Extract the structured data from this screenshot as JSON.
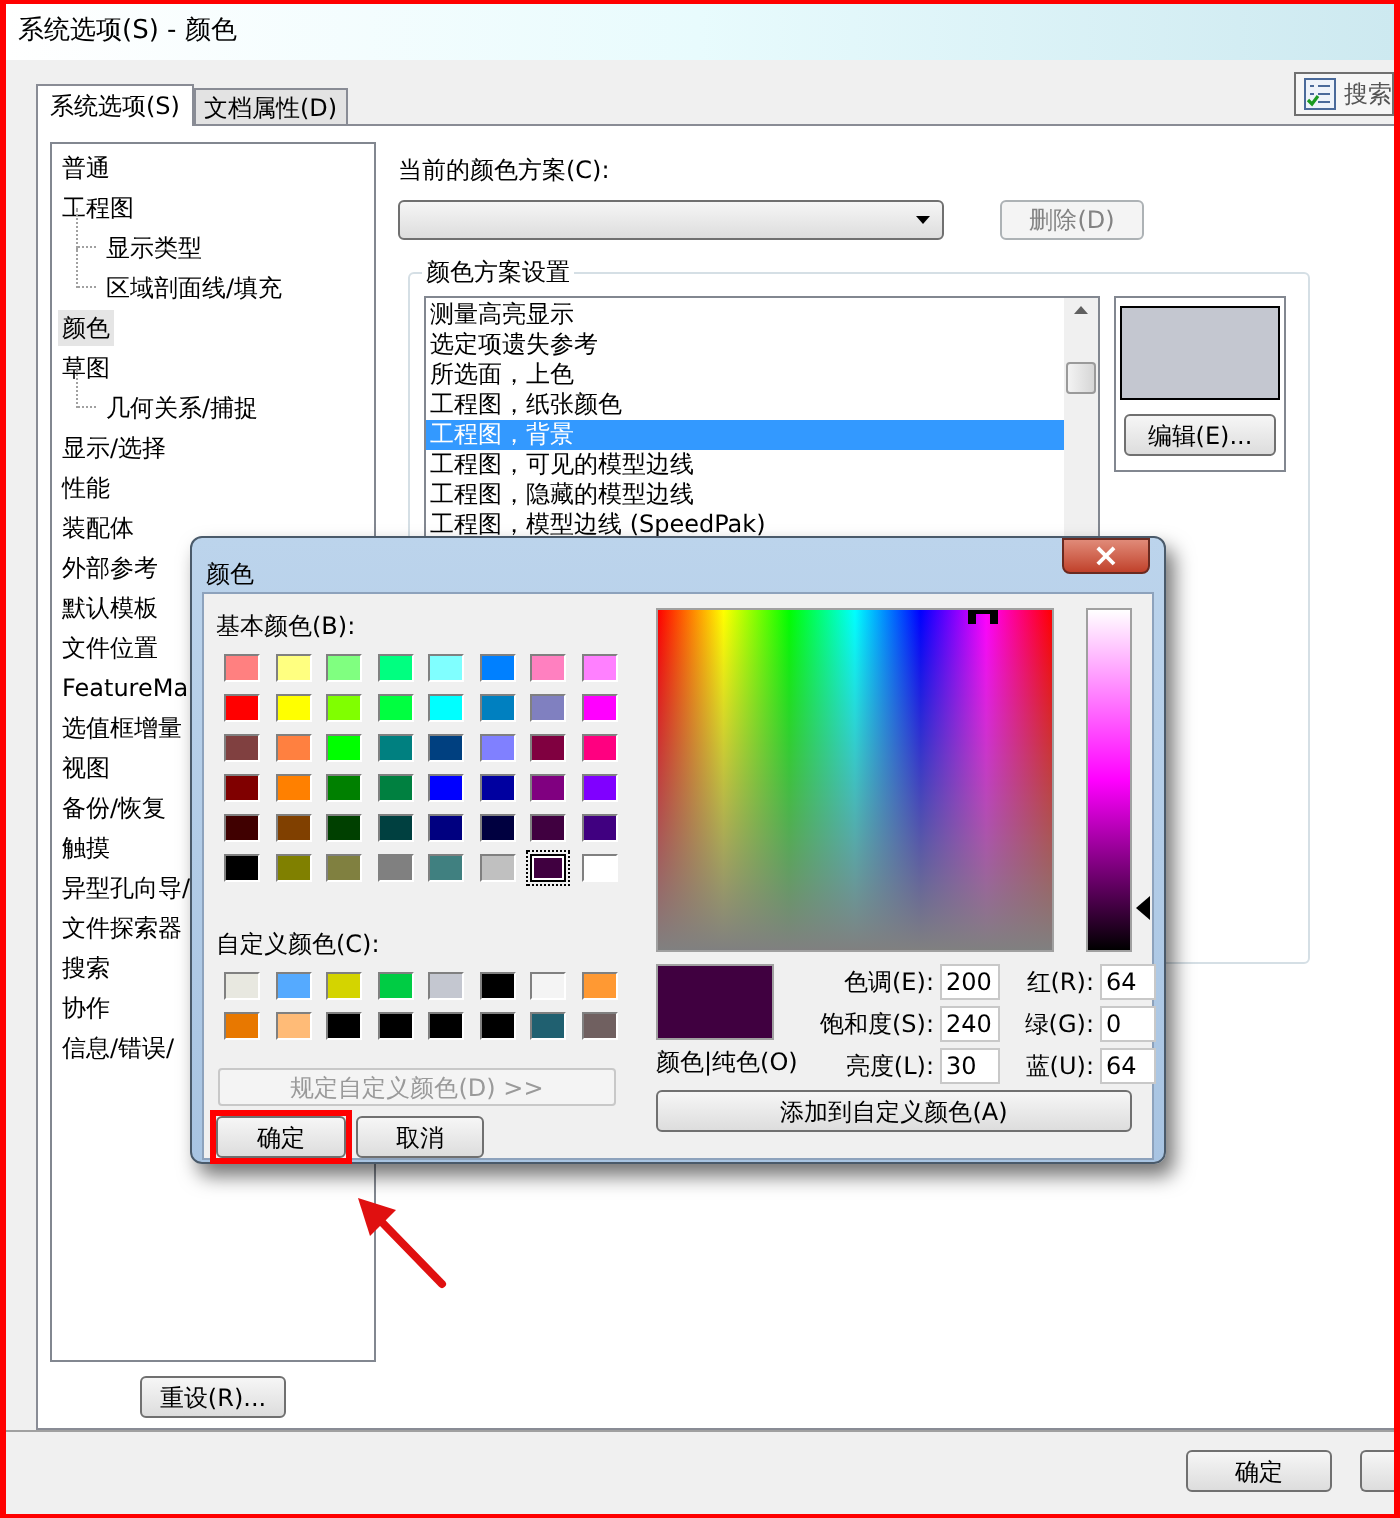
{
  "window": {
    "title": "系统选项(S) - 颜色"
  },
  "tabs": [
    {
      "label": "系统选项(S)",
      "selected": true
    },
    {
      "label": "文档属性(D)",
      "selected": false
    }
  ],
  "search_button": {
    "label": "搜索"
  },
  "tree": [
    {
      "label": "普通",
      "selected": false
    },
    {
      "label": "工程图",
      "selected": false,
      "children": [
        {
          "label": "显示类型",
          "selected": false
        },
        {
          "label": "区域剖面线/填充",
          "selected": false
        }
      ]
    },
    {
      "label": "颜色",
      "selected": true
    },
    {
      "label": "草图",
      "selected": false,
      "children": [
        {
          "label": "几何关系/捕捉",
          "selected": false
        }
      ]
    },
    {
      "label": "显示/选择",
      "selected": false
    },
    {
      "label": "性能",
      "selected": false
    },
    {
      "label": "装配体",
      "selected": false
    },
    {
      "label": "外部参考",
      "selected": false
    },
    {
      "label": "默认模板",
      "selected": false
    },
    {
      "label": "文件位置",
      "selected": false
    },
    {
      "label": "FeatureMa",
      "selected": false
    },
    {
      "label": "选值框增量",
      "selected": false
    },
    {
      "label": "视图",
      "selected": false
    },
    {
      "label": "备份/恢复",
      "selected": false
    },
    {
      "label": "触摸",
      "selected": false
    },
    {
      "label": "异型孔向导/",
      "selected": false
    },
    {
      "label": "文件探索器",
      "selected": false
    },
    {
      "label": "搜索",
      "selected": false
    },
    {
      "label": "协作",
      "selected": false
    },
    {
      "label": "信息/错误/",
      "selected": false
    }
  ],
  "reset_button": {
    "label": "重设(R)..."
  },
  "color_scheme": {
    "label": "当前的颜色方案(C):",
    "delete_button": {
      "label": "删除(D)",
      "disabled": true
    }
  },
  "scheme_settings": {
    "title": "颜色方案设置",
    "items": [
      {
        "label": "测量高亮显示",
        "selected": false
      },
      {
        "label": "选定项遗失参考",
        "selected": false
      },
      {
        "label": "所选面，上色",
        "selected": false
      },
      {
        "label": "工程图，纸张颜色",
        "selected": false
      },
      {
        "label": "工程图，背景",
        "selected": true
      },
      {
        "label": "工程图，可见的模型边线",
        "selected": false
      },
      {
        "label": "工程图，隐藏的模型边线",
        "selected": false
      },
      {
        "label": "工程图，模型边线 (SpeedPak)",
        "selected": false
      }
    ],
    "swatch": {
      "color": "#c4c7d0"
    },
    "edit_button": {
      "label": "编辑(E)..."
    }
  },
  "footer_buttons": [
    {
      "label": "确定"
    }
  ],
  "color_dialog": {
    "title": "颜色",
    "close_label": "×",
    "basic_label": "基本颜色(B):",
    "basic_colors": [
      {
        "color": "#ff8080",
        "selected": false
      },
      {
        "color": "#ffff80",
        "selected": false
      },
      {
        "color": "#80ff80",
        "selected": false
      },
      {
        "color": "#00ff80",
        "selected": false
      },
      {
        "color": "#80ffff",
        "selected": false
      },
      {
        "color": "#0080ff",
        "selected": false
      },
      {
        "color": "#ff80c0",
        "selected": false
      },
      {
        "color": "#ff80ff",
        "selected": false
      },
      {
        "color": "#ff0000",
        "selected": false
      },
      {
        "color": "#ffff00",
        "selected": false
      },
      {
        "color": "#80ff00",
        "selected": false
      },
      {
        "color": "#00ff40",
        "selected": false
      },
      {
        "color": "#00ffff",
        "selected": false
      },
      {
        "color": "#0080c0",
        "selected": false
      },
      {
        "color": "#8080c0",
        "selected": false
      },
      {
        "color": "#ff00ff",
        "selected": false
      },
      {
        "color": "#804040",
        "selected": false
      },
      {
        "color": "#ff8040",
        "selected": false
      },
      {
        "color": "#00ff00",
        "selected": false
      },
      {
        "color": "#008080",
        "selected": false
      },
      {
        "color": "#004080",
        "selected": false
      },
      {
        "color": "#8080ff",
        "selected": false
      },
      {
        "color": "#800040",
        "selected": false
      },
      {
        "color": "#ff0080",
        "selected": false
      },
      {
        "color": "#800000",
        "selected": false
      },
      {
        "color": "#ff8000",
        "selected": false
      },
      {
        "color": "#008000",
        "selected": false
      },
      {
        "color": "#008040",
        "selected": false
      },
      {
        "color": "#0000ff",
        "selected": false
      },
      {
        "color": "#0000a0",
        "selected": false
      },
      {
        "color": "#800080",
        "selected": false
      },
      {
        "color": "#8000ff",
        "selected": false
      },
      {
        "color": "#400000",
        "selected": false
      },
      {
        "color": "#804000",
        "selected": false
      },
      {
        "color": "#004000",
        "selected": false
      },
      {
        "color": "#004040",
        "selected": false
      },
      {
        "color": "#000080",
        "selected": false
      },
      {
        "color": "#000040",
        "selected": false
      },
      {
        "color": "#400040",
        "selected": false
      },
      {
        "color": "#400080",
        "selected": false
      },
      {
        "color": "#000000",
        "selected": false
      },
      {
        "color": "#808000",
        "selected": false
      },
      {
        "color": "#808040",
        "selected": false
      },
      {
        "color": "#808080",
        "selected": false
      },
      {
        "color": "#408080",
        "selected": false
      },
      {
        "color": "#c0c0c0",
        "selected": false
      },
      {
        "color": "#400040",
        "selected": true
      },
      {
        "color": "#ffffff",
        "selected": false
      }
    ],
    "custom_label": "自定义颜色(C):",
    "custom_colors": [
      {
        "color": "#e8e8e0",
        "selected": false
      },
      {
        "color": "#55aaff",
        "selected": false
      },
      {
        "color": "#d4d400",
        "selected": false
      },
      {
        "color": "#00cc44",
        "selected": false
      },
      {
        "color": "#c4c7d0",
        "selected": false
      },
      {
        "color": "#000000",
        "selected": false
      },
      {
        "color": "#f4f4f4",
        "selected": false
      },
      {
        "color": "#ff9933",
        "selected": false
      },
      {
        "color": "#e87800",
        "selected": false
      },
      {
        "color": "#ffbb77",
        "selected": false
      },
      {
        "color": "#000000",
        "selected": false
      },
      {
        "color": "#000000",
        "selected": false
      },
      {
        "color": "#000000",
        "selected": false
      },
      {
        "color": "#000000",
        "selected": false
      },
      {
        "color": "#206070",
        "selected": false
      },
      {
        "color": "#706060",
        "selected": false
      }
    ],
    "define_button": {
      "label": "规定自定义颜色(D) >>",
      "disabled": true
    },
    "ok_button": {
      "label": "确定"
    },
    "cancel_button": {
      "label": "取消"
    },
    "luminance_slider": {
      "level": 0.125
    },
    "preview": {
      "color": "#400040",
      "label": "颜色|纯色(O)"
    },
    "fields": [
      {
        "label": "色调(E):",
        "value": "200"
      },
      {
        "label": "红(R):",
        "value": "64"
      },
      {
        "label": "饱和度(S):",
        "value": "240"
      },
      {
        "label": "绿(G):",
        "value": "0"
      },
      {
        "label": "亮度(L):",
        "value": "30"
      },
      {
        "label": "蓝(U):",
        "value": "64"
      }
    ],
    "add_button": {
      "label": "添加到自定义颜色(A)"
    }
  }
}
